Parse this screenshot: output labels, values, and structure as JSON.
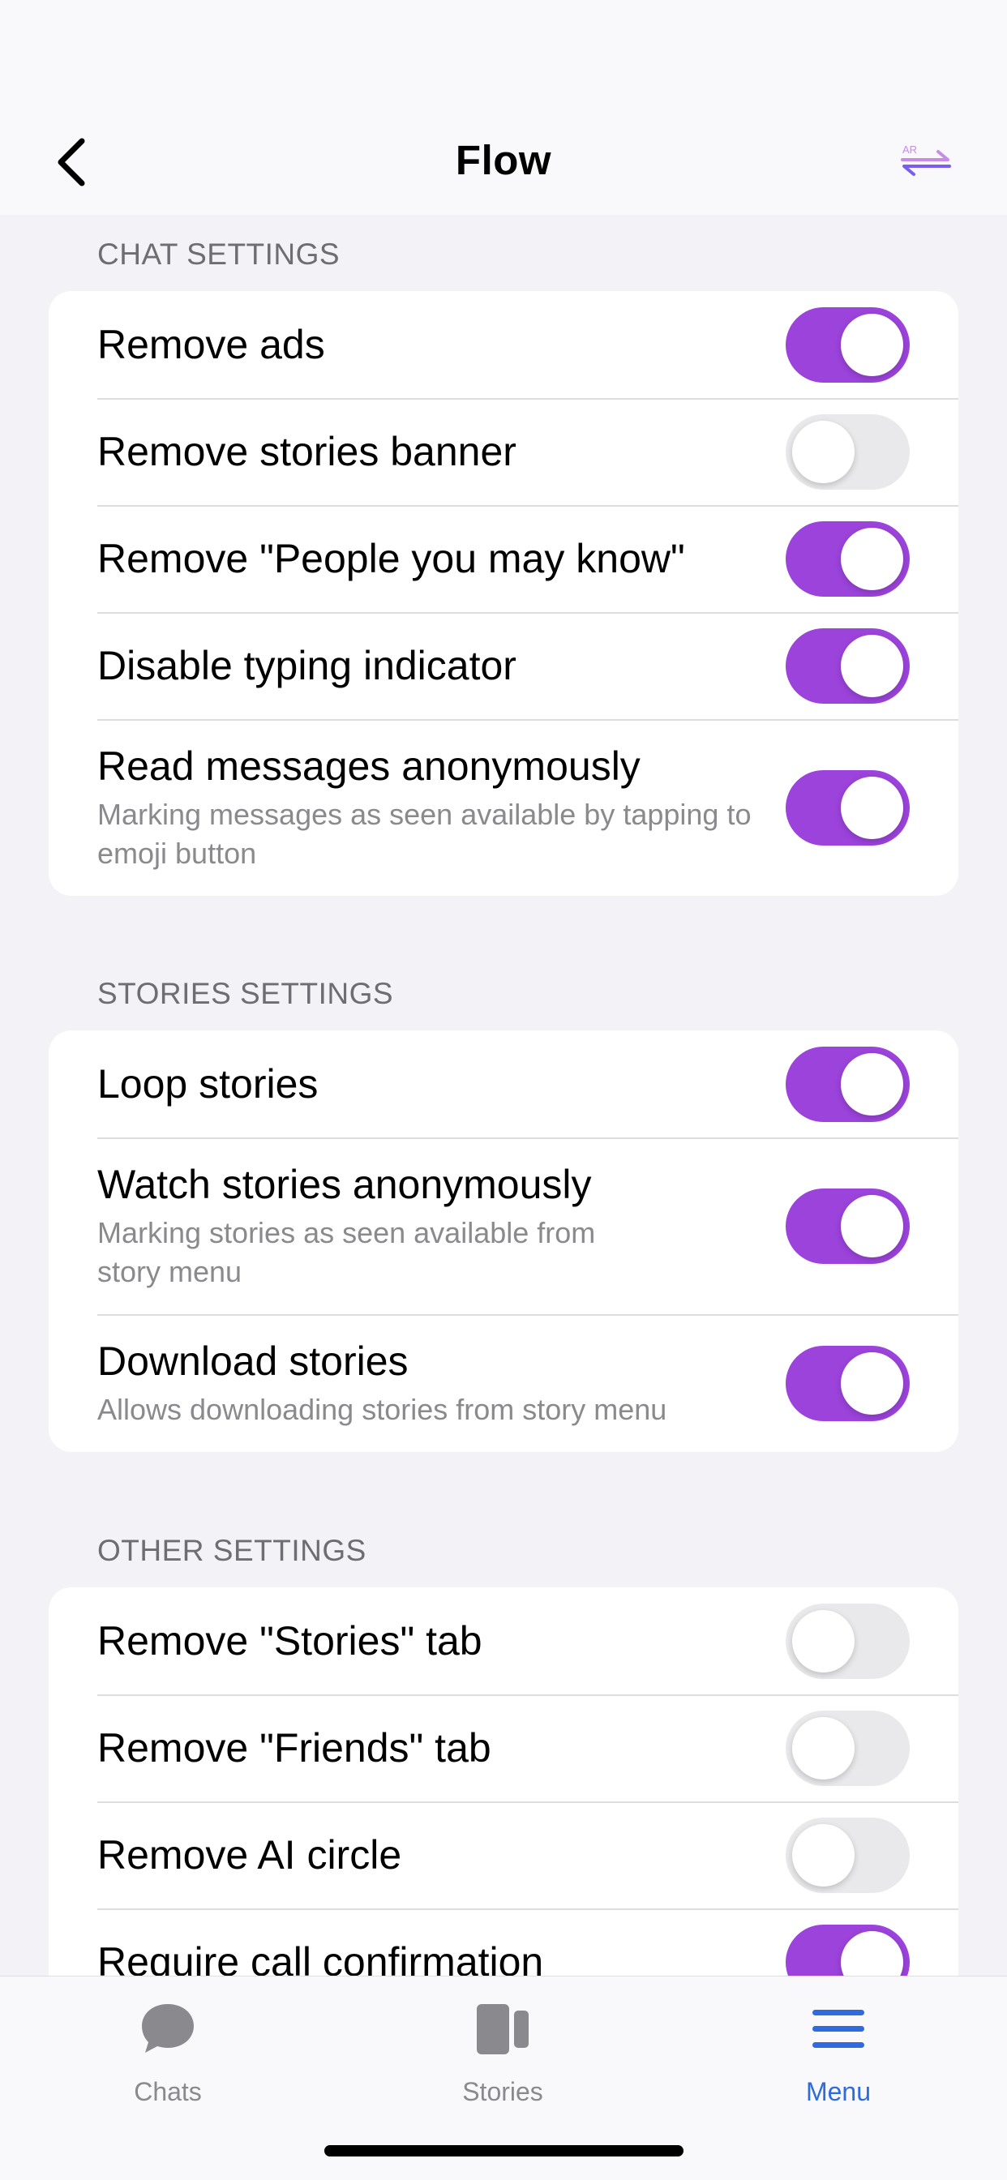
{
  "nav": {
    "title": "Flow",
    "back_icon": "chevron-left-icon",
    "translate_icon": "translate-icon",
    "translate_badge": "AR"
  },
  "colors": {
    "toggle_on": "#9B43DB",
    "toggle_off": "#E9E9EB",
    "tab_active": "#2F6BDE",
    "tab_inactive": "#8A8A8E"
  },
  "sections": [
    {
      "header": "CHAT SETTINGS",
      "rows": [
        {
          "title": "Remove ads",
          "on": true
        },
        {
          "title": "Remove stories banner",
          "on": false
        },
        {
          "title": "Remove \"People you may know\"",
          "on": true
        },
        {
          "title": "Disable typing indicator",
          "on": true
        },
        {
          "title": "Read messages anonymously",
          "subtitle": "Marking messages as seen available by tapping to emoji button",
          "on": true
        }
      ]
    },
    {
      "header": "STORIES SETTINGS",
      "rows": [
        {
          "title": "Loop stories",
          "on": true
        },
        {
          "title": "Watch stories anonymously",
          "subtitle": "Marking stories as seen available from story menu",
          "on": true
        },
        {
          "title": "Download stories",
          "subtitle": "Allows downloading stories from story menu",
          "on": true
        }
      ]
    },
    {
      "header": "OTHER SETTINGS",
      "rows": [
        {
          "title": "Remove \"Stories\" tab",
          "on": false
        },
        {
          "title": "Remove \"Friends\" tab",
          "on": false
        },
        {
          "title": "Remove AI circle",
          "on": false
        },
        {
          "title": "Require call confirmation",
          "on": true
        }
      ]
    }
  ],
  "tabs": [
    {
      "label": "Chats",
      "icon": "chat-bubble-icon",
      "active": false
    },
    {
      "label": "Stories",
      "icon": "stories-icon",
      "active": false
    },
    {
      "label": "Menu",
      "icon": "menu-icon",
      "active": true
    }
  ]
}
